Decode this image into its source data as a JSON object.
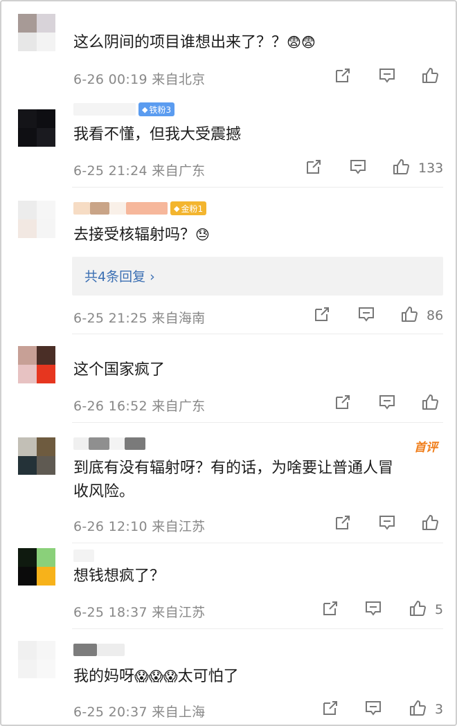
{
  "comments": [
    {
      "text": "这么阴间的项目谁想出来了？？",
      "emoji": "😨😨",
      "time": "6-26 00:19",
      "location": "来自北京",
      "likes": ""
    },
    {
      "badge": "铁粉3",
      "text": "我看不懂，但我大受震撼",
      "emoji": "",
      "time": "6-25 21:24",
      "location": "来自广东",
      "likes": "133"
    },
    {
      "badge": "金粉1",
      "text": "去接受核辐射吗？",
      "emoji": "😓",
      "reply": "共4条回复 ›",
      "time": "6-25 21:25",
      "location": "来自海南",
      "likes": "86"
    },
    {
      "text": "这个国家疯了",
      "emoji": "",
      "time": "6-26 16:52",
      "location": "来自广东",
      "likes": ""
    },
    {
      "tag": "首评",
      "text_line1": "到底有没有辐射呀？有的话，为啥要让普通人冒",
      "text_line2": "收风险。",
      "time": "6-26 12:10",
      "location": "来自江苏",
      "likes": ""
    },
    {
      "text": "想钱想疯了？",
      "emoji": "",
      "time": "6-25 18:37",
      "location": "来自江苏",
      "likes": "5"
    },
    {
      "text_pre": "我的妈呀",
      "emoji": "😱😱😱",
      "text_post": "太可怕了",
      "time": "6-25 20:37",
      "location": "来自上海",
      "likes": "3"
    }
  ],
  "icons": {
    "share": "share-icon",
    "comment": "comment-icon",
    "like": "like-icon"
  },
  "colors": {
    "meta": "#888888",
    "reply_link": "#3b6fb3",
    "first_tag": "#f07e1b"
  }
}
